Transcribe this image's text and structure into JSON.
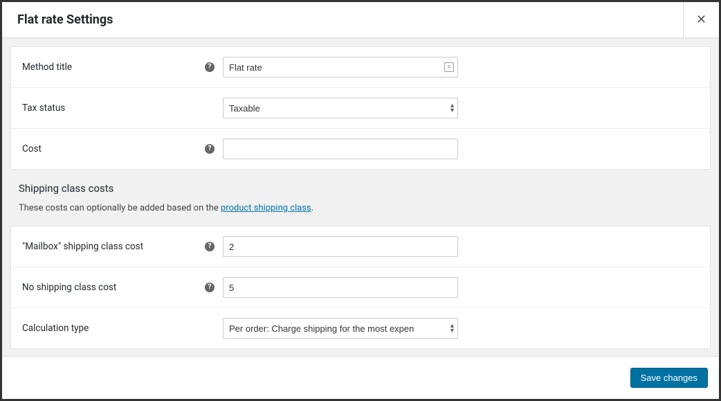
{
  "modal": {
    "title": "Flat rate Settings",
    "close_label": "✕"
  },
  "fields": {
    "method_title": {
      "label": "Method title",
      "value": "Flat rate",
      "has_help": true
    },
    "tax_status": {
      "label": "Tax status",
      "value": "Taxable",
      "has_help": false
    },
    "cost": {
      "label": "Cost",
      "value": "",
      "has_help": true
    },
    "mailbox_cost": {
      "label": "\"Mailbox\" shipping class cost",
      "value": "2",
      "has_help": true
    },
    "no_class_cost": {
      "label": "No shipping class cost",
      "value": "5",
      "has_help": true
    },
    "calc_type": {
      "label": "Calculation type",
      "value": "Per order: Charge shipping for the most expen",
      "has_help": false
    }
  },
  "section": {
    "title": "Shipping class costs",
    "desc_prefix": "These costs can optionally be added based on the ",
    "link_text": "product shipping class",
    "desc_suffix": "."
  },
  "footer": {
    "save_label": "Save changes"
  }
}
